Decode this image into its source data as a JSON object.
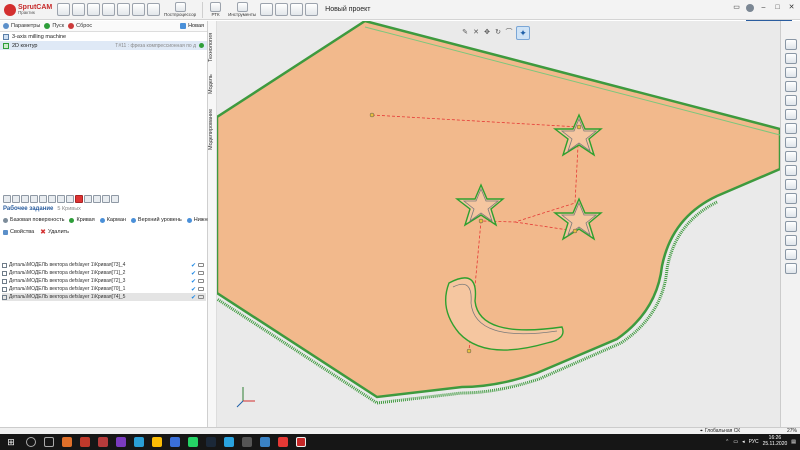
{
  "app": {
    "name": "SprutCAM",
    "edition": "Практик",
    "project_title": "Новый проект"
  },
  "ribbon": {
    "postprocessor_label": "Постпроцессор",
    "rtk_label": "РТК",
    "tools_label": "Инструменты"
  },
  "left_panel": {
    "tabs": {
      "params": "Параметры",
      "start": "Пуск",
      "reset": "Сброс"
    },
    "new_label": "Новая",
    "tree": [
      {
        "label": "3-axis milling machine",
        "sub": ""
      },
      {
        "label": "2D контур",
        "sub": "T#11 : фреза компрессионная по д"
      }
    ],
    "vertical_tabs": {
      "technology": "Технология",
      "model": "Модель",
      "modeling": "Моделирование"
    },
    "job_section": {
      "title": "Рабочее задание",
      "count": "5 Кривых"
    },
    "actions": [
      "Базовая поверхность",
      "Кривая",
      "Карман",
      "Верхний уровень",
      "Нижний ур"
    ],
    "props": {
      "properties": "Свойства",
      "delete": "Удалить"
    },
    "curves": [
      "Деталь\\МОДЕЛЬ вектора defslayer 1\\Кривая[73]_4",
      "Деталь\\МОДЕЛЬ вектора defslayer 1\\Кривая[71]_2",
      "Деталь\\МОДЕЛЬ вектора defslayer 1\\Кривая[72]_3",
      "Деталь\\МОДЕЛЬ вектора defslayer 1\\Кривая[70]_1",
      "Деталь\\МОДЕЛЬ вектора defslayer 1\\Кривая[74]_5"
    ]
  },
  "status_bar": {
    "coordinate_system": "Глобальная СК",
    "zoom": "27%"
  },
  "taskbar": {
    "lang": "РУС",
    "time": "16:26",
    "date": "25.11.2020"
  },
  "colors": {
    "part_fill": "#f2b98c",
    "toolpath": "#2ea02e",
    "link_path": "#e53935",
    "accent": "#2a5d9f"
  }
}
